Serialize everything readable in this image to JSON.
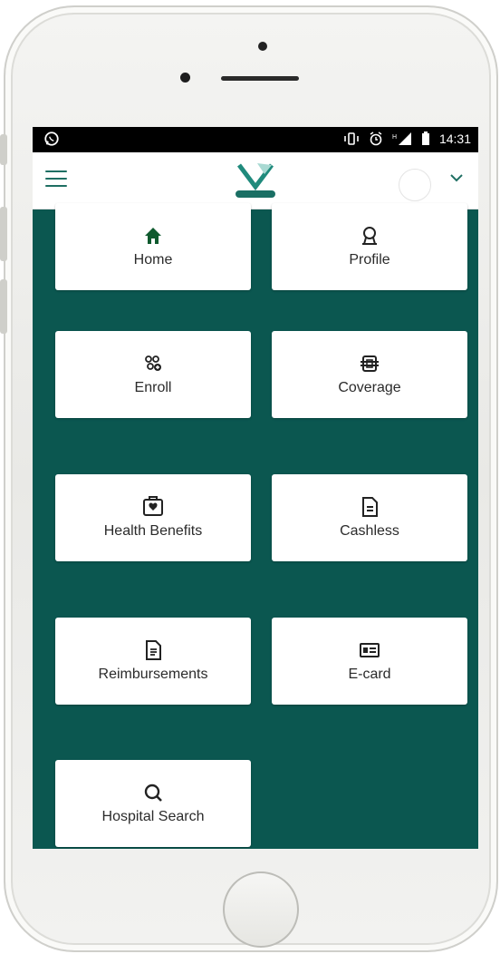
{
  "status_bar": {
    "time": "14:31",
    "icons": [
      "whatsapp-icon",
      "vibrate-icon",
      "alarm-icon",
      "signal-icon",
      "battery-icon"
    ]
  },
  "app_bar": {
    "menu_icon": "hamburger-icon",
    "logo_icon": "brand-logo",
    "account_icon": "avatar",
    "dropdown_icon": "chevron-down-icon"
  },
  "theme": {
    "background": "#0b5750",
    "accent": "#1f6f63",
    "home_icon_color": "#0f5a2e"
  },
  "tiles": [
    {
      "label": "Home",
      "icon": "home-icon"
    },
    {
      "label": "Profile",
      "icon": "profile-icon"
    },
    {
      "label": "Enroll",
      "icon": "enroll-icon"
    },
    {
      "label": "Coverage",
      "icon": "coverage-icon"
    },
    {
      "label": "Health Benefits",
      "icon": "health-benefits-icon"
    },
    {
      "label": "Cashless",
      "icon": "cashless-icon"
    },
    {
      "label": "Reimbursements",
      "icon": "reimbursements-icon"
    },
    {
      "label": "E-card",
      "icon": "ecard-icon"
    },
    {
      "label": "Hospital Search",
      "icon": "hospital-search-icon"
    }
  ]
}
